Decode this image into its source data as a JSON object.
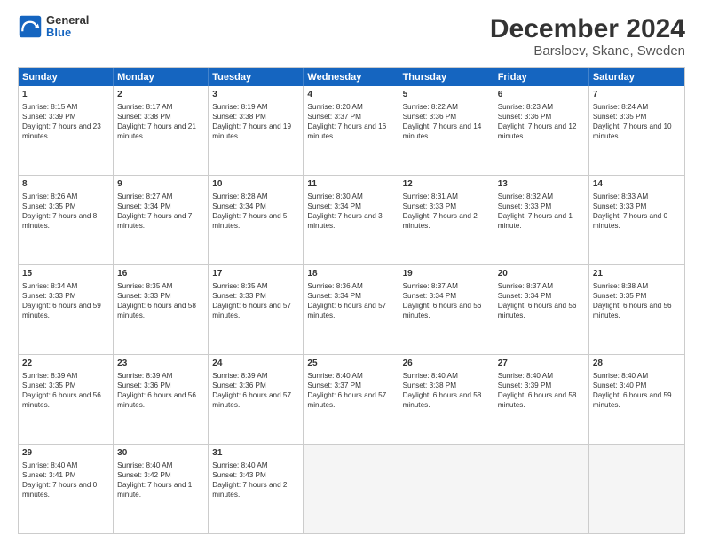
{
  "header": {
    "logo_general": "General",
    "logo_blue": "Blue",
    "title": "December 2024",
    "subtitle": "Barsloev, Skane, Sweden"
  },
  "calendar": {
    "days": [
      "Sunday",
      "Monday",
      "Tuesday",
      "Wednesday",
      "Thursday",
      "Friday",
      "Saturday"
    ],
    "weeks": [
      [
        {
          "day": "1",
          "sunrise": "Sunrise: 8:15 AM",
          "sunset": "Sunset: 3:39 PM",
          "daylight": "Daylight: 7 hours and 23 minutes."
        },
        {
          "day": "2",
          "sunrise": "Sunrise: 8:17 AM",
          "sunset": "Sunset: 3:38 PM",
          "daylight": "Daylight: 7 hours and 21 minutes."
        },
        {
          "day": "3",
          "sunrise": "Sunrise: 8:19 AM",
          "sunset": "Sunset: 3:38 PM",
          "daylight": "Daylight: 7 hours and 19 minutes."
        },
        {
          "day": "4",
          "sunrise": "Sunrise: 8:20 AM",
          "sunset": "Sunset: 3:37 PM",
          "daylight": "Daylight: 7 hours and 16 minutes."
        },
        {
          "day": "5",
          "sunrise": "Sunrise: 8:22 AM",
          "sunset": "Sunset: 3:36 PM",
          "daylight": "Daylight: 7 hours and 14 minutes."
        },
        {
          "day": "6",
          "sunrise": "Sunrise: 8:23 AM",
          "sunset": "Sunset: 3:36 PM",
          "daylight": "Daylight: 7 hours and 12 minutes."
        },
        {
          "day": "7",
          "sunrise": "Sunrise: 8:24 AM",
          "sunset": "Sunset: 3:35 PM",
          "daylight": "Daylight: 7 hours and 10 minutes."
        }
      ],
      [
        {
          "day": "8",
          "sunrise": "Sunrise: 8:26 AM",
          "sunset": "Sunset: 3:35 PM",
          "daylight": "Daylight: 7 hours and 8 minutes."
        },
        {
          "day": "9",
          "sunrise": "Sunrise: 8:27 AM",
          "sunset": "Sunset: 3:34 PM",
          "daylight": "Daylight: 7 hours and 7 minutes."
        },
        {
          "day": "10",
          "sunrise": "Sunrise: 8:28 AM",
          "sunset": "Sunset: 3:34 PM",
          "daylight": "Daylight: 7 hours and 5 minutes."
        },
        {
          "day": "11",
          "sunrise": "Sunrise: 8:30 AM",
          "sunset": "Sunset: 3:34 PM",
          "daylight": "Daylight: 7 hours and 3 minutes."
        },
        {
          "day": "12",
          "sunrise": "Sunrise: 8:31 AM",
          "sunset": "Sunset: 3:33 PM",
          "daylight": "Daylight: 7 hours and 2 minutes."
        },
        {
          "day": "13",
          "sunrise": "Sunrise: 8:32 AM",
          "sunset": "Sunset: 3:33 PM",
          "daylight": "Daylight: 7 hours and 1 minute."
        },
        {
          "day": "14",
          "sunrise": "Sunrise: 8:33 AM",
          "sunset": "Sunset: 3:33 PM",
          "daylight": "Daylight: 7 hours and 0 minutes."
        }
      ],
      [
        {
          "day": "15",
          "sunrise": "Sunrise: 8:34 AM",
          "sunset": "Sunset: 3:33 PM",
          "daylight": "Daylight: 6 hours and 59 minutes."
        },
        {
          "day": "16",
          "sunrise": "Sunrise: 8:35 AM",
          "sunset": "Sunset: 3:33 PM",
          "daylight": "Daylight: 6 hours and 58 minutes."
        },
        {
          "day": "17",
          "sunrise": "Sunrise: 8:35 AM",
          "sunset": "Sunset: 3:33 PM",
          "daylight": "Daylight: 6 hours and 57 minutes."
        },
        {
          "day": "18",
          "sunrise": "Sunrise: 8:36 AM",
          "sunset": "Sunset: 3:34 PM",
          "daylight": "Daylight: 6 hours and 57 minutes."
        },
        {
          "day": "19",
          "sunrise": "Sunrise: 8:37 AM",
          "sunset": "Sunset: 3:34 PM",
          "daylight": "Daylight: 6 hours and 56 minutes."
        },
        {
          "day": "20",
          "sunrise": "Sunrise: 8:37 AM",
          "sunset": "Sunset: 3:34 PM",
          "daylight": "Daylight: 6 hours and 56 minutes."
        },
        {
          "day": "21",
          "sunrise": "Sunrise: 8:38 AM",
          "sunset": "Sunset: 3:35 PM",
          "daylight": "Daylight: 6 hours and 56 minutes."
        }
      ],
      [
        {
          "day": "22",
          "sunrise": "Sunrise: 8:39 AM",
          "sunset": "Sunset: 3:35 PM",
          "daylight": "Daylight: 6 hours and 56 minutes."
        },
        {
          "day": "23",
          "sunrise": "Sunrise: 8:39 AM",
          "sunset": "Sunset: 3:36 PM",
          "daylight": "Daylight: 6 hours and 56 minutes."
        },
        {
          "day": "24",
          "sunrise": "Sunrise: 8:39 AM",
          "sunset": "Sunset: 3:36 PM",
          "daylight": "Daylight: 6 hours and 57 minutes."
        },
        {
          "day": "25",
          "sunrise": "Sunrise: 8:40 AM",
          "sunset": "Sunset: 3:37 PM",
          "daylight": "Daylight: 6 hours and 57 minutes."
        },
        {
          "day": "26",
          "sunrise": "Sunrise: 8:40 AM",
          "sunset": "Sunset: 3:38 PM",
          "daylight": "Daylight: 6 hours and 58 minutes."
        },
        {
          "day": "27",
          "sunrise": "Sunrise: 8:40 AM",
          "sunset": "Sunset: 3:39 PM",
          "daylight": "Daylight: 6 hours and 58 minutes."
        },
        {
          "day": "28",
          "sunrise": "Sunrise: 8:40 AM",
          "sunset": "Sunset: 3:40 PM",
          "daylight": "Daylight: 6 hours and 59 minutes."
        }
      ],
      [
        {
          "day": "29",
          "sunrise": "Sunrise: 8:40 AM",
          "sunset": "Sunset: 3:41 PM",
          "daylight": "Daylight: 7 hours and 0 minutes."
        },
        {
          "day": "30",
          "sunrise": "Sunrise: 8:40 AM",
          "sunset": "Sunset: 3:42 PM",
          "daylight": "Daylight: 7 hours and 1 minute."
        },
        {
          "day": "31",
          "sunrise": "Sunrise: 8:40 AM",
          "sunset": "Sunset: 3:43 PM",
          "daylight": "Daylight: 7 hours and 2 minutes."
        },
        null,
        null,
        null,
        null
      ]
    ]
  }
}
